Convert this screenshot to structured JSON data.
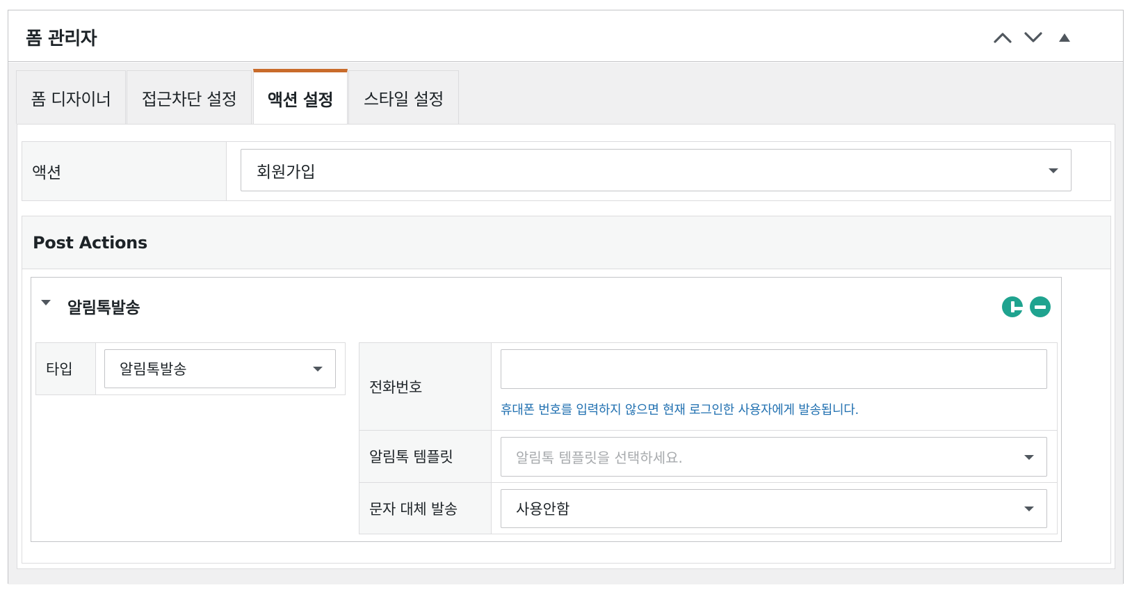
{
  "panel": {
    "title": "폼 관리자",
    "controls": [
      "chevron-up-icon",
      "chevron-down-icon",
      "triangle-up-icon"
    ]
  },
  "tabs": [
    {
      "label": "폼 디자이너",
      "active": false
    },
    {
      "label": "접근차단 설정",
      "active": false
    },
    {
      "label": "액션 설정",
      "active": true
    },
    {
      "label": "스타일 설정",
      "active": false
    }
  ],
  "action": {
    "label": "액션",
    "value": "회원가입"
  },
  "post_actions": {
    "heading": "Post Actions",
    "item": {
      "title": "알림톡발송",
      "type_label": "타입",
      "type_value": "알림톡발송",
      "phone_label": "전화번호",
      "phone_value": "",
      "phone_help": "휴대폰 번호를 입력하지 않으면 현재 로그인한 사용자에게 발송됩니다.",
      "template_label": "알림톡 템플릿",
      "template_placeholder": "알림톡 템플릿을 선택하세요.",
      "fallback_label": "문자 대체 발송",
      "fallback_value": "사용안함"
    }
  },
  "colors": {
    "active_tab_accent": "#c96b2a",
    "add_remove_button": "#1fa38f",
    "help_text": "#2271b1"
  }
}
